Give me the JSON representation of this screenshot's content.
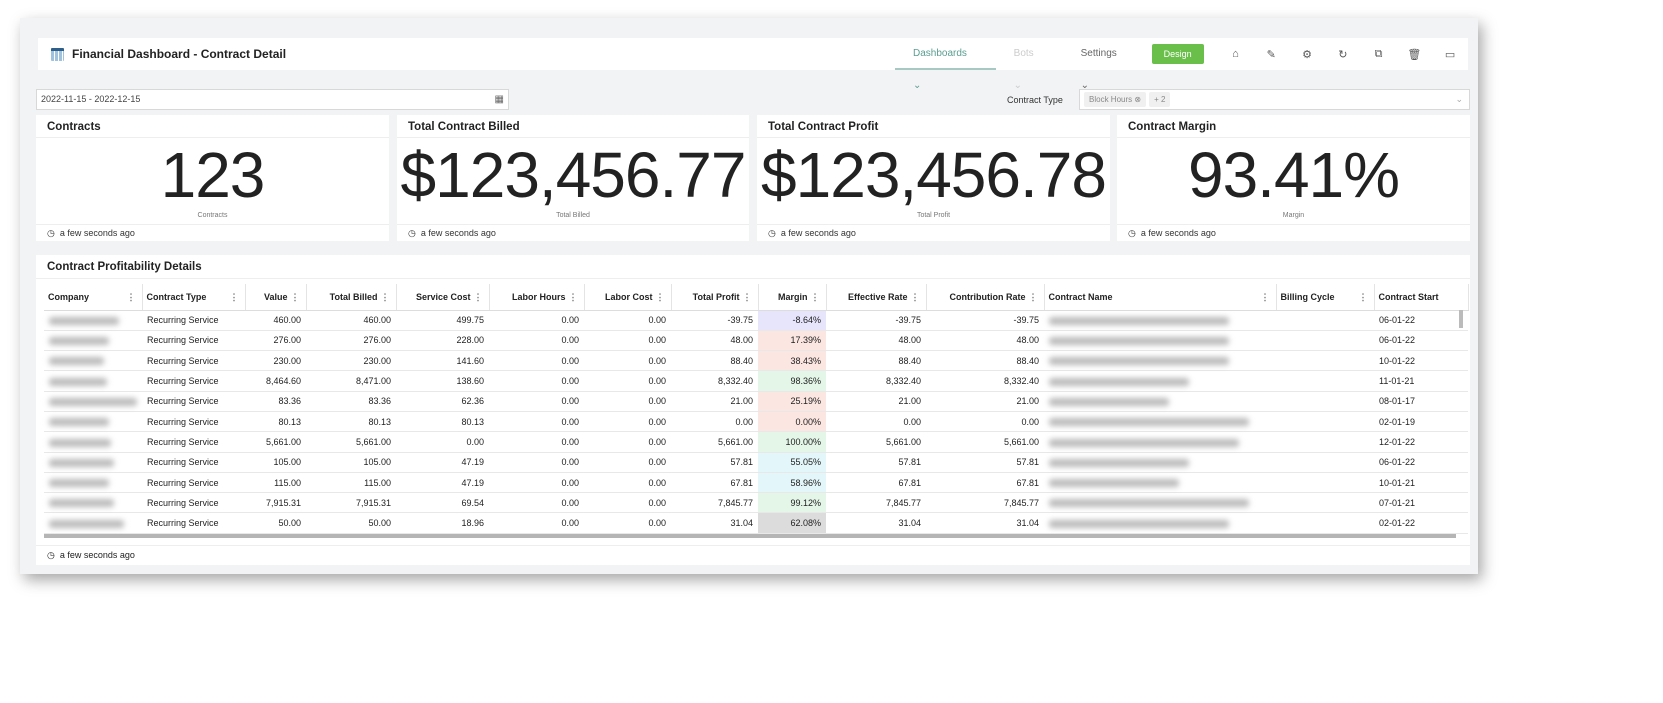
{
  "header": {
    "title": "Financial Dashboard - Contract Detail",
    "nav": [
      {
        "label": "Dashboards ⌄",
        "state": "active"
      },
      {
        "label": "Bots ⌄",
        "state": "disabled"
      },
      {
        "label": "Settings ⌄",
        "state": "normal"
      }
    ],
    "design_label": "Design",
    "icons": [
      "home-settings-icon",
      "pencil-icon",
      "gear-icon",
      "refresh-icon",
      "copy-icon",
      "trash-icon",
      "present-icon"
    ]
  },
  "filters": {
    "date_range": "2022-11-15 - 2022-12-15",
    "contract_type_label": "Contract Type",
    "contract_type_chip": "Block Hours",
    "contract_type_more": "+ 2"
  },
  "cards": [
    {
      "title": "Contracts",
      "value": "123",
      "caption": "Contracts",
      "updated": "a few seconds ago"
    },
    {
      "title": "Total Contract Billed",
      "value": "$123,456.77",
      "caption": "Total Billed",
      "updated": "a few seconds ago"
    },
    {
      "title": "Total Contract Profit",
      "value": "$123,456.78",
      "caption": "Total Profit",
      "updated": "a few seconds ago"
    },
    {
      "title": "Contract Margin",
      "value": "93.41%",
      "caption": "Margin",
      "updated": "a few seconds ago"
    }
  ],
  "table": {
    "title": "Contract Profitability Details",
    "updated": "a few seconds ago",
    "columns": [
      "Company",
      "Contract Type",
      "Value",
      "Total Billed",
      "Service Cost",
      "Labor Hours",
      "Labor Cost",
      "Total Profit",
      "Margin",
      "Effective Rate",
      "Contribution Rate",
      "Contract Name",
      "Billing Cycle",
      "Contract Start"
    ],
    "margin_colors": {
      "negative": "#e7e5fb",
      "low": "#fbe6e1",
      "mid": "#e3f6f9",
      "high": "#e3f6e8",
      "other": "#dcdcdc"
    },
    "rows": [
      [
        "Recurring Service",
        "460.00",
        "460.00",
        "499.75",
        "0.00",
        "0.00",
        "-39.75",
        "-8.64%",
        "-39.75",
        "-39.75",
        "06-01-22",
        "negative"
      ],
      [
        "Recurring Service",
        "276.00",
        "276.00",
        "228.00",
        "0.00",
        "0.00",
        "48.00",
        "17.39%",
        "48.00",
        "48.00",
        "06-01-22",
        "low"
      ],
      [
        "Recurring Service",
        "230.00",
        "230.00",
        "141.60",
        "0.00",
        "0.00",
        "88.40",
        "38.43%",
        "88.40",
        "88.40",
        "10-01-22",
        "low"
      ],
      [
        "Recurring Service",
        "8,464.60",
        "8,471.00",
        "138.60",
        "0.00",
        "0.00",
        "8,332.40",
        "98.36%",
        "8,332.40",
        "8,332.40",
        "11-01-21",
        "high"
      ],
      [
        "Recurring Service",
        "83.36",
        "83.36",
        "62.36",
        "0.00",
        "0.00",
        "21.00",
        "25.19%",
        "21.00",
        "21.00",
        "08-01-17",
        "low"
      ],
      [
        "Recurring Service",
        "80.13",
        "80.13",
        "80.13",
        "0.00",
        "0.00",
        "0.00",
        "0.00%",
        "0.00",
        "0.00",
        "02-01-19",
        "low"
      ],
      [
        "Recurring Service",
        "5,661.00",
        "5,661.00",
        "0.00",
        "0.00",
        "0.00",
        "5,661.00",
        "100.00%",
        "5,661.00",
        "5,661.00",
        "12-01-22",
        "high"
      ],
      [
        "Recurring Service",
        "105.00",
        "105.00",
        "47.19",
        "0.00",
        "0.00",
        "57.81",
        "55.05%",
        "57.81",
        "57.81",
        "06-01-22",
        "mid"
      ],
      [
        "Recurring Service",
        "115.00",
        "115.00",
        "47.19",
        "0.00",
        "0.00",
        "67.81",
        "58.96%",
        "67.81",
        "67.81",
        "10-01-21",
        "mid"
      ],
      [
        "Recurring Service",
        "7,915.31",
        "7,915.31",
        "69.54",
        "0.00",
        "0.00",
        "7,845.77",
        "99.12%",
        "7,845.77",
        "7,845.77",
        "07-01-21",
        "high"
      ],
      [
        "Recurring Service",
        "50.00",
        "50.00",
        "18.96",
        "0.00",
        "0.00",
        "31.04",
        "62.08%",
        "31.04",
        "31.04",
        "02-01-22",
        "other"
      ]
    ]
  }
}
